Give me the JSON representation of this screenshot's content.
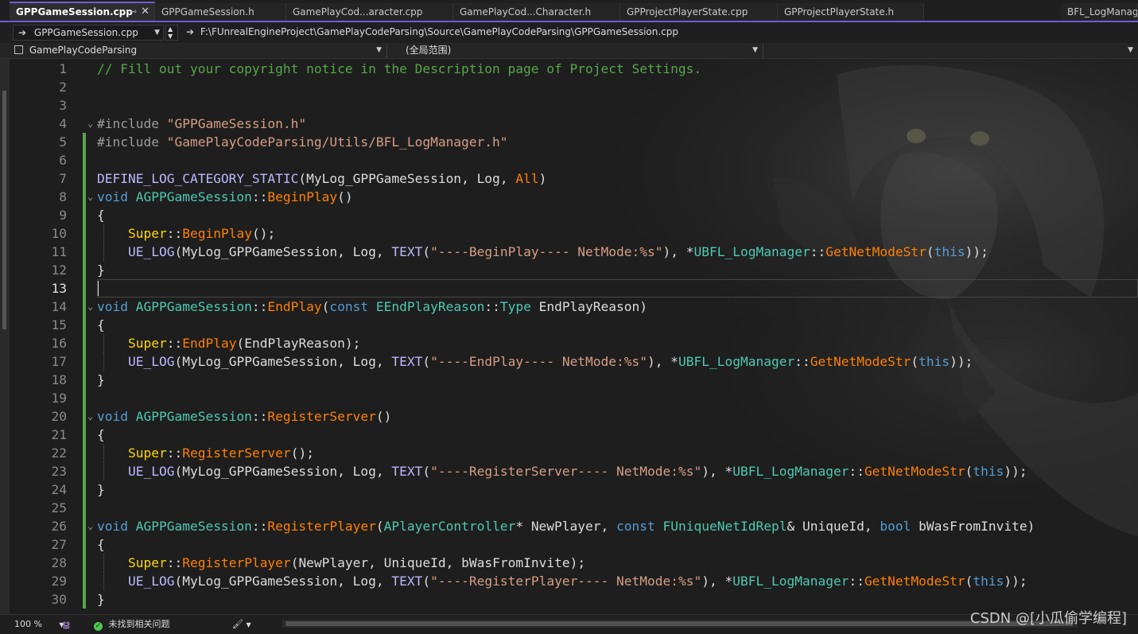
{
  "tabs": [
    {
      "label": "GPPGameSession.cpp",
      "active": true
    },
    {
      "label": "GPPGameSession.h"
    },
    {
      "label": "GamePlayCod...aracter.cpp"
    },
    {
      "label": "GamePlayCod...Character.h"
    },
    {
      "label": "GPProjectPlayerState.cpp"
    },
    {
      "label": "GPProjectPlayerState.h"
    },
    {
      "label": "BFL_LogManage"
    }
  ],
  "navbar": {
    "file_combo": "GPPGameSession.cpp",
    "path": "F:\\FUnrealEngineProject\\GamePlayCodeParsing\\Source\\GamePlayCodeParsing\\GPPGameSession.cpp"
  },
  "scopebar": {
    "project": "GamePlayCodeParsing",
    "scope": "(全局范围)",
    "member": ""
  },
  "code_lines": [
    {
      "n": "1",
      "text": "// Fill out your copyright notice in the Description page of Project Settings."
    },
    {
      "n": "2",
      "text": ""
    },
    {
      "n": "3",
      "text": ""
    },
    {
      "n": "4",
      "text": "#include \"GPPGameSession.h\""
    },
    {
      "n": "5",
      "text": "#include \"GamePlayCodeParsing/Utils/BFL_LogManager.h\""
    },
    {
      "n": "6",
      "text": ""
    },
    {
      "n": "7",
      "text": "DEFINE_LOG_CATEGORY_STATIC(MyLog_GPPGameSession, Log, All)"
    },
    {
      "n": "8",
      "text": "void AGPPGameSession::BeginPlay()"
    },
    {
      "n": "9",
      "text": "{"
    },
    {
      "n": "10",
      "text": "    Super::BeginPlay();"
    },
    {
      "n": "11",
      "text": "    UE_LOG(MyLog_GPPGameSession, Log, TEXT(\"----BeginPlay---- NetMode:%s\"), *UBFL_LogManager::GetNetModeStr(this));"
    },
    {
      "n": "12",
      "text": "}"
    },
    {
      "n": "13",
      "text": ""
    },
    {
      "n": "14",
      "text": "void AGPPGameSession::EndPlay(const EEndPlayReason::Type EndPlayReason)"
    },
    {
      "n": "15",
      "text": "{"
    },
    {
      "n": "16",
      "text": "    Super::EndPlay(EndPlayReason);"
    },
    {
      "n": "17",
      "text": "    UE_LOG(MyLog_GPPGameSession, Log, TEXT(\"----EndPlay---- NetMode:%s\"), *UBFL_LogManager::GetNetModeStr(this));"
    },
    {
      "n": "18",
      "text": "}"
    },
    {
      "n": "19",
      "text": ""
    },
    {
      "n": "20",
      "text": "void AGPPGameSession::RegisterServer()"
    },
    {
      "n": "21",
      "text": "{"
    },
    {
      "n": "22",
      "text": "    Super::RegisterServer();"
    },
    {
      "n": "23",
      "text": "    UE_LOG(MyLog_GPPGameSession, Log, TEXT(\"----RegisterServer---- NetMode:%s\"), *UBFL_LogManager::GetNetModeStr(this));"
    },
    {
      "n": "24",
      "text": "}"
    },
    {
      "n": "25",
      "text": ""
    },
    {
      "n": "26",
      "text": "void AGPPGameSession::RegisterPlayer(APlayerController* NewPlayer, const FUniqueNetIdRepl& UniqueId, bool bWasFromInvite)"
    },
    {
      "n": "27",
      "text": "{"
    },
    {
      "n": "28",
      "text": "    Super::RegisterPlayer(NewPlayer, UniqueId, bWasFromInvite);"
    },
    {
      "n": "29",
      "text": "    UE_LOG(MyLog_GPPGameSession, Log, TEXT(\"----RegisterPlayer---- NetMode:%s\"), *UBFL_LogManager::GetNetModeStr(this));"
    },
    {
      "n": "30",
      "text": "}"
    }
  ],
  "current_line": "13",
  "status": {
    "zoom": "100 %",
    "issues": "未找到相关问题"
  },
  "watermark": "CSDN @[小瓜偷学编程]",
  "colors": {
    "accent": "#6f5bd6",
    "comment": "#57a64a",
    "keyword": "#569cd6",
    "function": "#ff8000",
    "string": "#d69d85",
    "change_bar": "#57a64a"
  }
}
